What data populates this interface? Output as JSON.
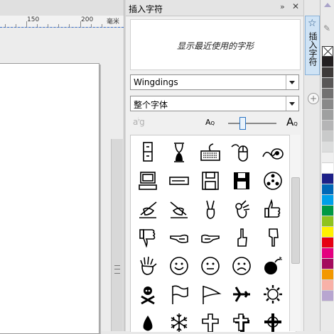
{
  "ruler": {
    "labels": [
      "150",
      "200"
    ],
    "unit": "毫米"
  },
  "docker": {
    "title": "插入字符",
    "arrows_icon": "double-arrow-icon",
    "close_icon": "close-icon",
    "recent_placeholder": "显示最近使用的字形",
    "font": {
      "selected": "Wingdings"
    },
    "subset": {
      "selected": "整个字体"
    },
    "zoom": {
      "min_label": "A",
      "max_label": "A",
      "level": 0.3
    },
    "glyph_icons": [
      "filing-cabinet-icon",
      "hourglass-icon",
      "keyboard-icon",
      "mouse-icon",
      "trackball-icon",
      "computer-icon",
      "hard-disk-icon",
      "floppy-disk-icon",
      "floppy-disk-black-icon",
      "tape-reel-icon",
      "writing-hand-icon",
      "writing-hand-left-icon",
      "victory-hand-icon",
      "ok-hand-icon",
      "thumbs-up-icon",
      "thumbs-down-icon",
      "pointing-left-icon",
      "pointing-right-icon",
      "pointing-up-icon",
      "pointing-down-icon",
      "open-hand-icon",
      "smiley-face-icon",
      "neutral-face-icon",
      "frowning-face-icon",
      "bomb-icon",
      "skull-crossbones-icon",
      "white-flag-icon",
      "pennant-flag-icon",
      "airplane-icon",
      "sun-icon",
      "droplet-icon",
      "snowflake-icon",
      "latin-cross-icon",
      "shadowed-cross-icon",
      "celtic-cross-icon"
    ]
  },
  "vtab": {
    "label": "插入字符",
    "icon": "star-icon"
  },
  "palette": {
    "colors": [
      "#231f20",
      "#3e3a39",
      "#595757",
      "#727171",
      "#898989",
      "#9fa0a0",
      "#b5b5b6",
      "#c9caca",
      "#dcdddd",
      "#efefef",
      "#ffffff",
      "#1d2088",
      "#0068b7",
      "#00a0e9",
      "#009944",
      "#8fc31f",
      "#fff100",
      "#e60012",
      "#e4007f",
      "#a40b5d",
      "#f39800",
      "#f8b1a8",
      "#b8a6d0"
    ]
  }
}
